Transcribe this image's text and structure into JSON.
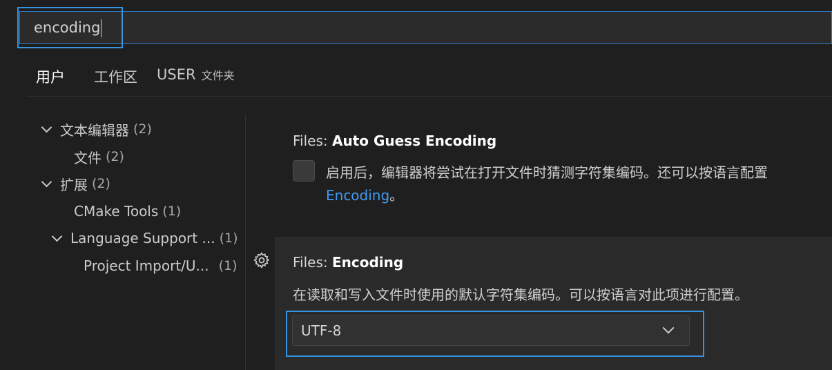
{
  "search": {
    "value": "encoding"
  },
  "tabs": [
    {
      "label": "用户"
    },
    {
      "label": "工作区"
    },
    {
      "label": "USER",
      "tag": "文件夹"
    }
  ],
  "toc": [
    {
      "label": "文本编辑器",
      "count": "(2)"
    },
    {
      "label": "文件",
      "count": "(2)"
    },
    {
      "label": "扩展",
      "count": "(2)"
    },
    {
      "label": "CMake Tools",
      "count": "(1)"
    },
    {
      "label": "Language Support ...",
      "count": "(1)"
    },
    {
      "label": "Project Import/U...",
      "count": "(1)"
    }
  ],
  "settings": [
    {
      "category": "Files:",
      "name": "Auto Guess Encoding",
      "checked": false,
      "desc_line1": "启用后，编辑器将尝试在打开文件时猜测字符集编码。还可以按语言配置",
      "desc_link": "Encoding",
      "desc_end": "。"
    },
    {
      "category": "Files:",
      "name": "Encoding",
      "desc": "在读取和写入文件时使用的默认字符集编码。可以按语言对此项进行配置。",
      "value": "UTF-8"
    }
  ],
  "colors": {
    "accent": "#3794e0",
    "link": "#3f9cf0",
    "background": "#1f1f1f"
  }
}
